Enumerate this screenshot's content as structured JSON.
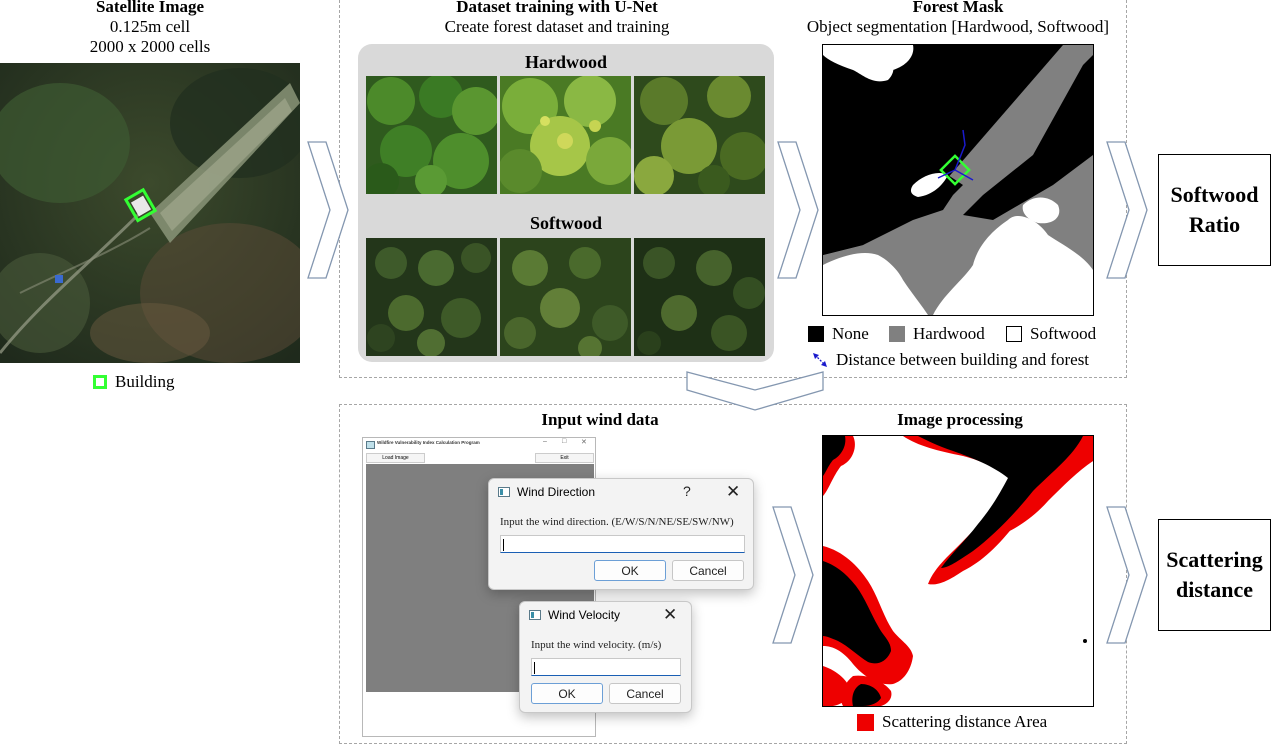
{
  "satellite": {
    "title": "Satellite Image",
    "cell": "0.125m cell",
    "cells": "2000 x 2000 cells",
    "legend_building": "Building",
    "building_color": "#33ff33"
  },
  "training": {
    "title": "Dataset training with U-Net",
    "subtitle": "Create forest dataset and training",
    "hardwood_label": "Hardwood",
    "softwood_label": "Softwood"
  },
  "forest_mask": {
    "title": "Forest Mask",
    "subtitle": "Object segmentation [Hardwood, Softwood]",
    "legend": [
      {
        "label": "None",
        "color": "#000000"
      },
      {
        "label": "Hardwood",
        "color": "#808080"
      },
      {
        "label": "Softwood",
        "color": "#ffffff"
      }
    ],
    "distance_label": "Distance between building and forest",
    "distance_color": "#1a1acc"
  },
  "outputs": {
    "softwood_ratio": [
      "Softwood",
      "Ratio"
    ],
    "scattering_distance": [
      "Scattering",
      "distance"
    ]
  },
  "wind": {
    "title": "Input wind data",
    "app_window": {
      "title": "Wildfire Vulnerability Index Calculation Program",
      "load_button": "Load Image",
      "exit_button": "Exit"
    },
    "direction_dialog": {
      "title": "Wind Direction",
      "help": "?",
      "close": "✕",
      "prompt": "Input the wind direction. (E/W/S/N/NE/SE/SW/NW)",
      "value": "",
      "ok": "OK",
      "cancel": "Cancel"
    },
    "velocity_dialog": {
      "title": "Wind Velocity",
      "close": "✕",
      "prompt": "Input the wind velocity. (m/s)",
      "value": "",
      "ok": "OK",
      "cancel": "Cancel"
    }
  },
  "processing": {
    "title": "Image processing",
    "legend_label": "Scattering distance Area",
    "legend_color": "#ee0000"
  }
}
